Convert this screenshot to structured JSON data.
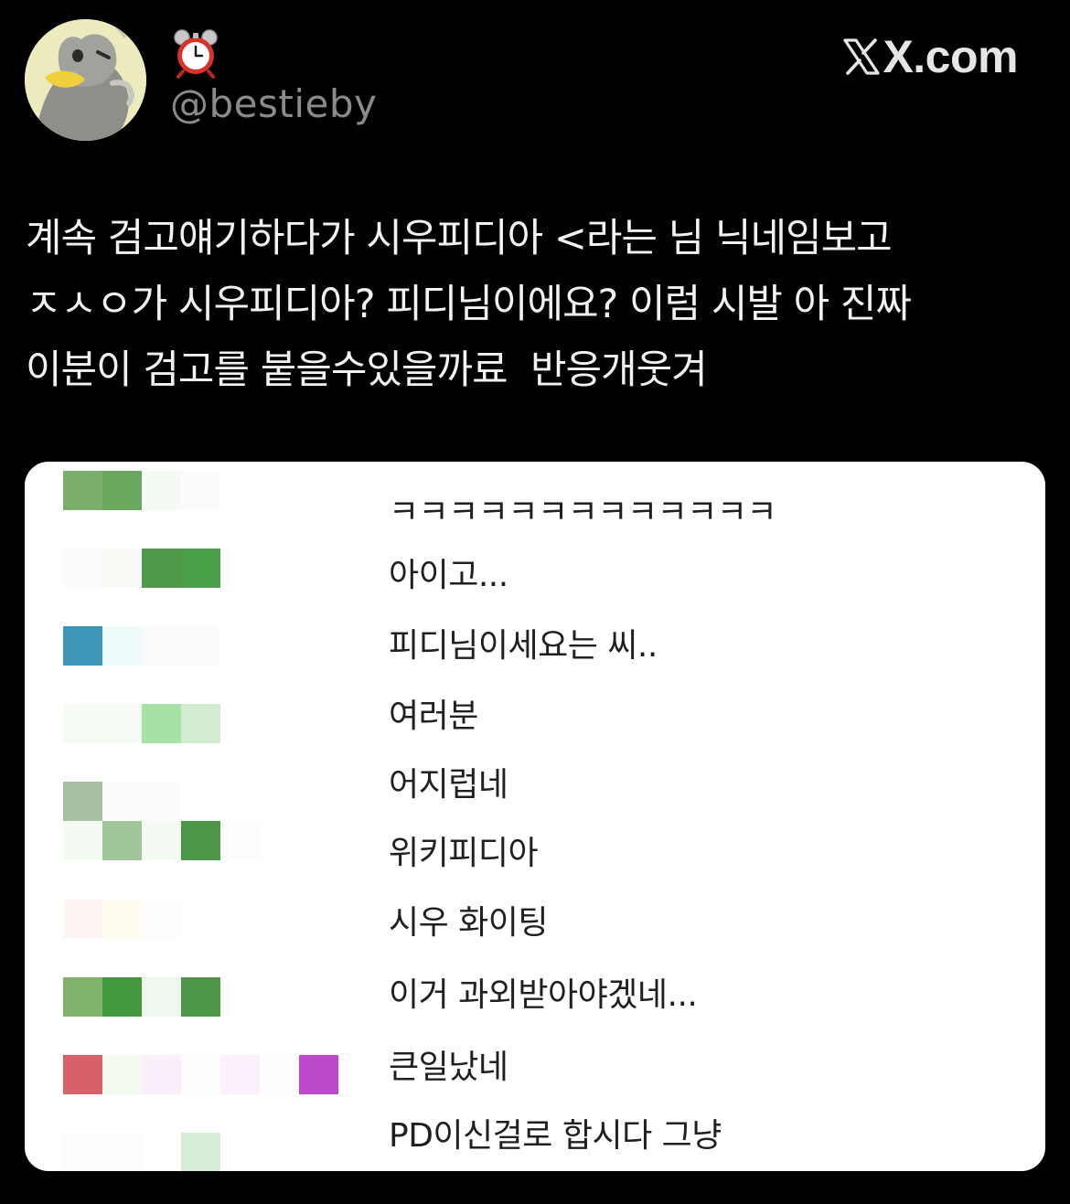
{
  "header": {
    "handle": "@bestieby",
    "brand": "X.com",
    "avatar_icon": "duck-cartoon-avatar",
    "status_emoji": "alarm-clock-icon"
  },
  "tweet": {
    "text": "계속 검고얘기하다가 시우피디아 <라는 님 닉네임보고\nㅈㅅㅇ가 시우피디아? 피디님이에요? 이럼 시발 아 진짜\n이분이 검고를 붙을수있을까료  반응개웃겨"
  },
  "chat": {
    "messages": [
      {
        "text": "ㅋㅋㅋㅋㅋㅋㅋㅋㅋㅋㅋㅋㅋ"
      },
      {
        "text": "아이고..."
      },
      {
        "text": "피디님이세요는 씨.."
      },
      {
        "text": "여러분"
      },
      {
        "text": "어지럽네"
      },
      {
        "text": "위키피디아"
      },
      {
        "text": "시우 화이팅"
      },
      {
        "text": "이거 과외받아야겠네..."
      },
      {
        "text": "큰일났네"
      },
      {
        "text": "PD이신걸로 합시다 그냥"
      }
    ]
  },
  "colors": {
    "background": "#000000",
    "card": "#ffffff",
    "handle": "#8a8a8a",
    "text": "#f2f2f2"
  }
}
